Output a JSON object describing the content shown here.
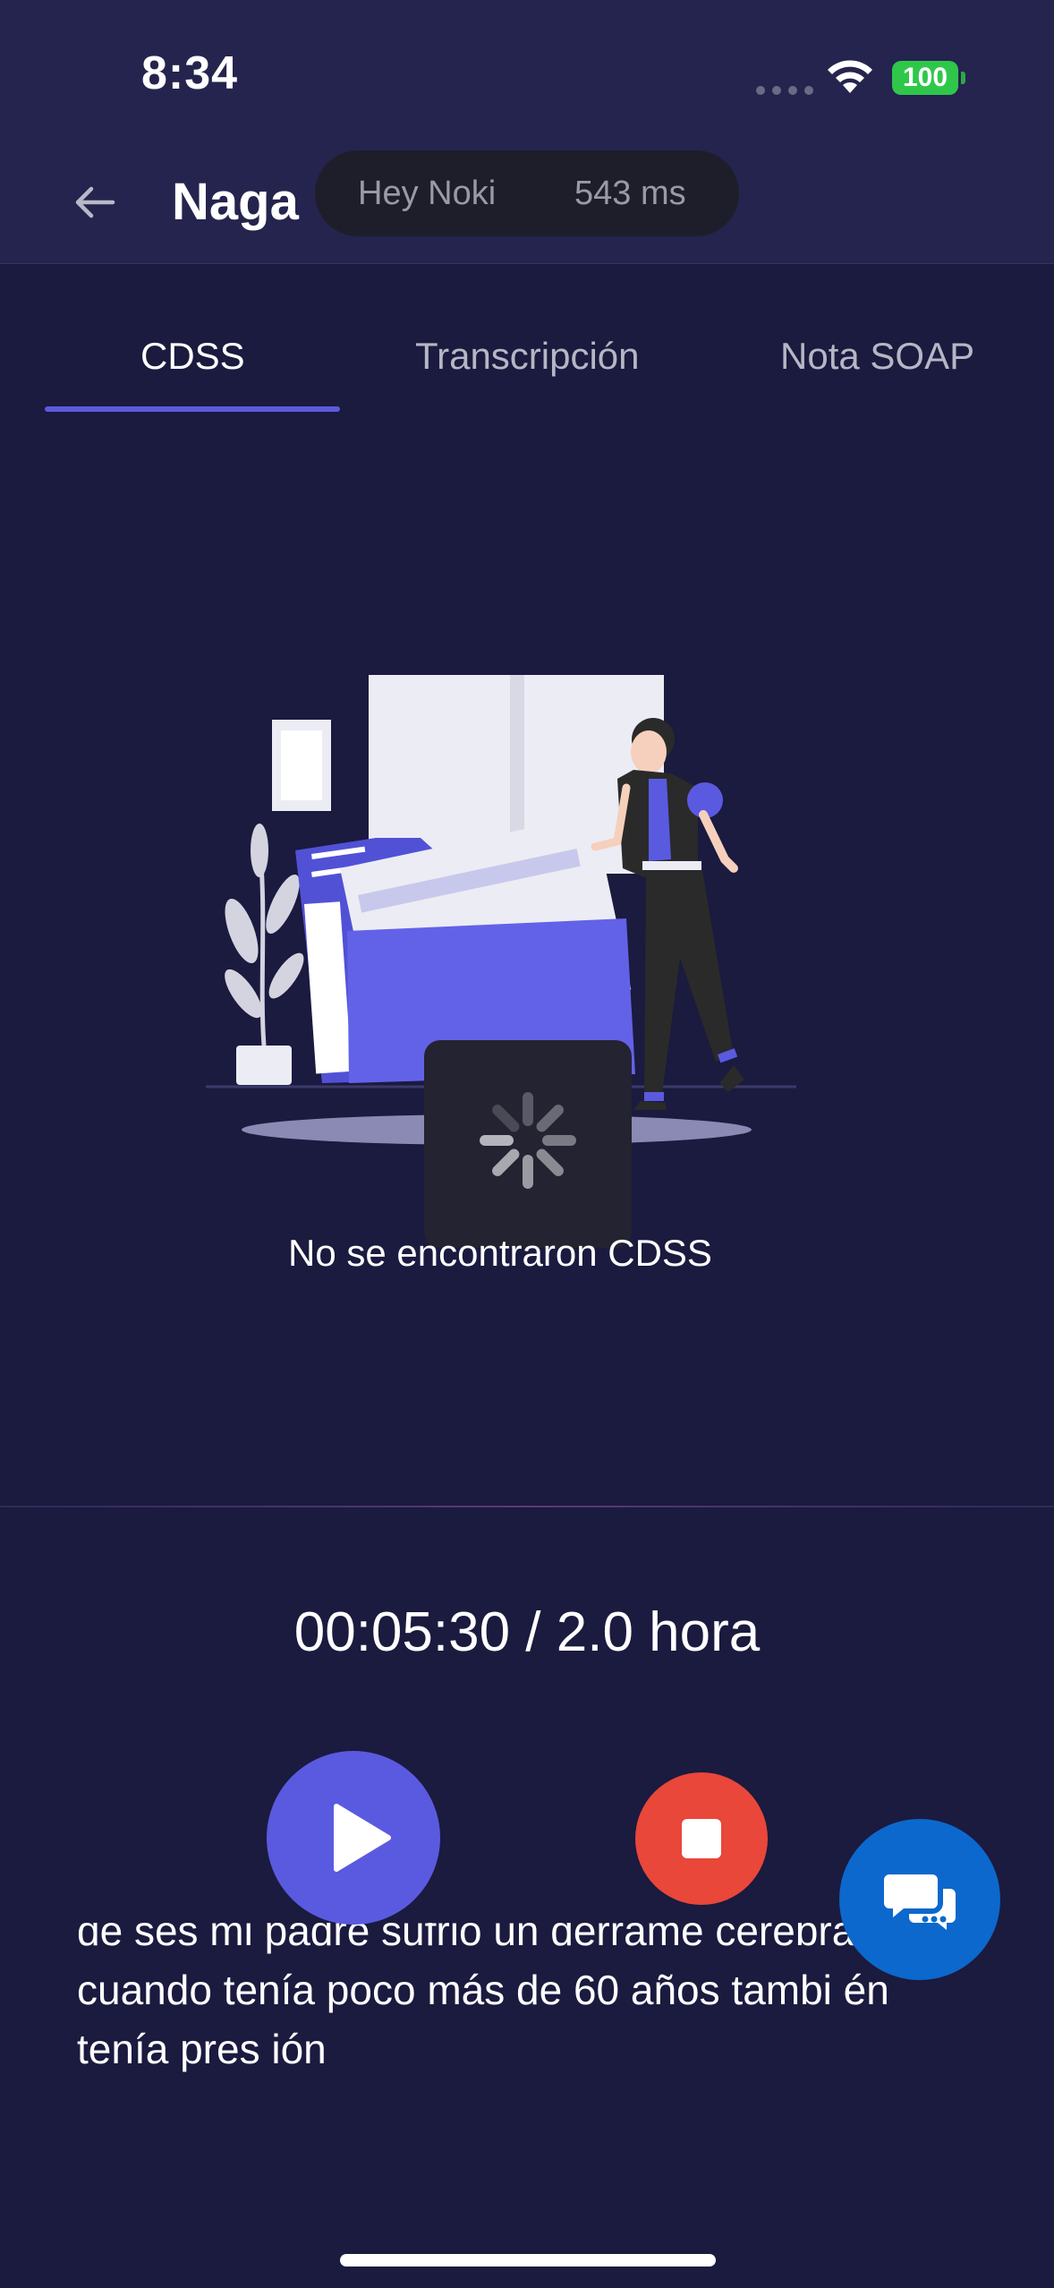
{
  "status_bar": {
    "time": "8:34",
    "battery": "100",
    "icons": [
      "cellular-dots-icon",
      "wifi-icon",
      "battery-icon"
    ]
  },
  "header": {
    "title": "Naga",
    "back_icon": "arrow-left-icon",
    "wake_word": "Hey Noki",
    "latency": "543 ms"
  },
  "tabs": [
    {
      "label": "CDSS",
      "active": true
    },
    {
      "label": "Transcripción",
      "active": false
    },
    {
      "label": "Nota SOAP",
      "active": false
    }
  ],
  "empty_state": {
    "message": "No se encontraron CDSS"
  },
  "recording": {
    "timer": "00:05:30 / 2.0 hora"
  },
  "transcript": {
    "partial_line": "de ses mi padre sufrió un derrame cerebral",
    "line_2": "cuando tenía poco más de 60 años  tambi én",
    "line_3": "tenía  pres ión"
  },
  "colors": {
    "header_bg": "#24244e",
    "page_bg": "#1b1a3f",
    "accent": "#5b5bdc",
    "stop": "#e8473a",
    "chat": "#0c68cc"
  }
}
